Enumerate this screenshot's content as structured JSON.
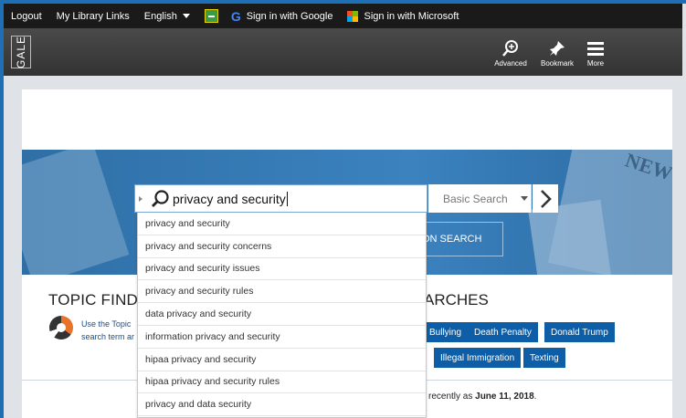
{
  "topbar": {
    "logout": "Logout",
    "library_links": "My Library Links",
    "language": "English",
    "google_signin": "Sign in with Google",
    "microsoft_signin": "Sign in with Microsoft"
  },
  "header": {
    "logo": "GALE",
    "tools": {
      "advanced": "Advanced",
      "bookmark": "Bookmark",
      "more": "More"
    }
  },
  "search": {
    "query": "privacy and security",
    "mode": "Basic Search",
    "suggestions": [
      "privacy and security",
      "privacy and security concerns",
      "privacy and security issues",
      "privacy and security rules",
      "data privacy and security",
      "information privacy and security",
      "hipaa privacy and security",
      "hipaa privacy and security rules",
      "privacy and data security"
    ],
    "hidden_button_partial": "ON SEARCH"
  },
  "topic_finder": {
    "title_partial": "TOPIC FIND",
    "desc_line1_partial": "Use the Topic",
    "desc_line2_partial": "search term ar"
  },
  "popular": {
    "title_partial": "ARCHES",
    "tags_row1": [
      "Bullying",
      "Death Penalty",
      "Donald Trump"
    ],
    "tags_row2": [
      "Illegal Immigration",
      "Texting"
    ],
    "updated_prefix": "recently as",
    "updated_date": "June 11, 2018",
    "updated_suffix": "."
  },
  "colors": {
    "accent": "#1f6fb5",
    "tag_bg": "#0d5ea6",
    "topbar_bg": "#1a1a1a"
  }
}
